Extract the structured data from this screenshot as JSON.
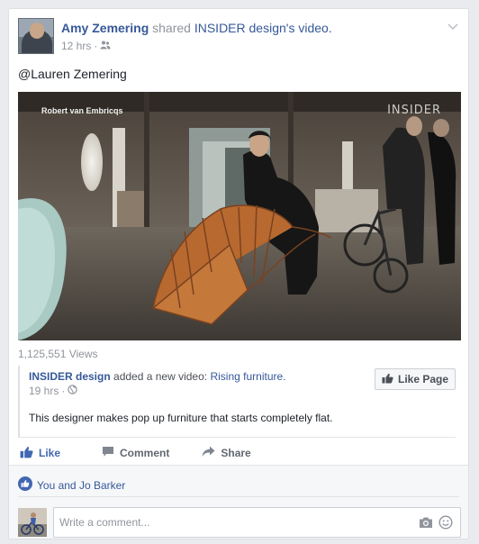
{
  "post": {
    "author": "Amy Zemering",
    "shared_text": "shared",
    "page_name": "INSIDER design",
    "page_suffix": "'s",
    "video_word": "video.",
    "time": "12 hrs",
    "separator": "·",
    "privacy_icon": "friends-icon",
    "text": "@Lauren Zemering"
  },
  "video": {
    "credit": "Robert van Embricqs",
    "brand": "INSIDER",
    "views": "1,125,551 Views"
  },
  "shared_post": {
    "page": "INSIDER design",
    "action_text": "added a new video:",
    "video_title": "Rising furniture.",
    "time": "19 hrs",
    "separator": "·",
    "privacy_icon": "globe-icon",
    "description": "This designer makes pop up furniture that starts completely flat.",
    "like_page_label": "Like Page"
  },
  "actions": {
    "like": "Like",
    "comment": "Comment",
    "share": "Share"
  },
  "reactions": {
    "text": "You and Jo Barker"
  },
  "comment_box": {
    "placeholder": "Write a comment..."
  },
  "colors": {
    "link": "#365899",
    "like_blue": "#4267b2",
    "meta_gray": "#90949c",
    "background": "#e9ebee"
  }
}
